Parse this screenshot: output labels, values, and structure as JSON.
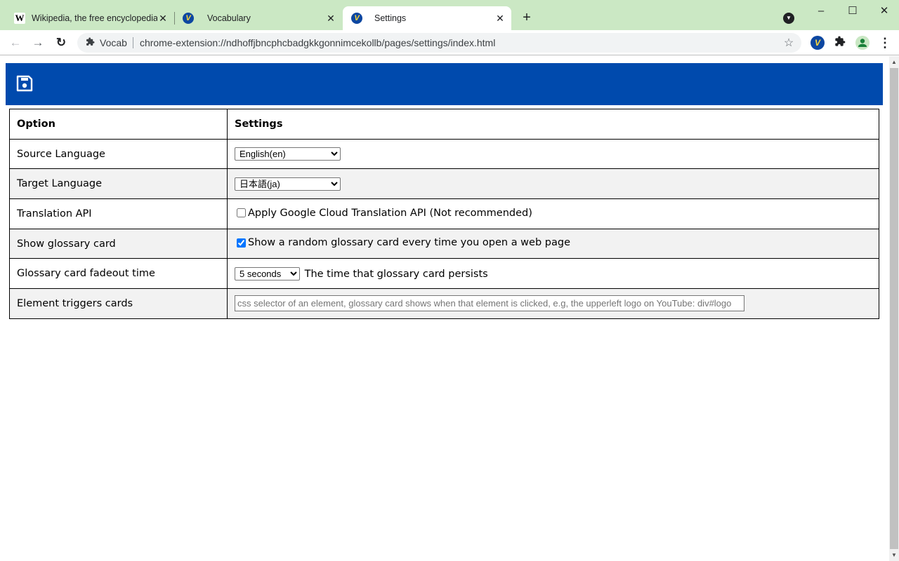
{
  "browser": {
    "tabs": [
      {
        "title": "Wikipedia, the free encyclopedia",
        "favicon": "wikipedia-w-icon",
        "favicon_glyph": "W",
        "active": false
      },
      {
        "title": "Vocabulary",
        "favicon": "vocab-extension-icon",
        "favicon_glyph": "V",
        "active": false
      },
      {
        "title": "Settings",
        "favicon": "vocab-extension-icon",
        "favicon_glyph": "V",
        "active": true
      }
    ],
    "close_glyph": "✕",
    "new_tab_glyph": "+",
    "tab_search_glyph": "▼",
    "window_controls": {
      "minimize": "–",
      "maximize": "☐",
      "close": "✕"
    },
    "nav": {
      "back": "←",
      "forward": "→",
      "reload": "↻"
    },
    "omnibox": {
      "chip_icon": "puzzle-piece-icon",
      "chip_label": "Vocab",
      "url": "chrome-extension://ndhoffjbncphcbadgkkgonnimcekollb/pages/settings/index.html",
      "bookmark_glyph": "☆"
    },
    "toolbar_icons": {
      "vocab": "V",
      "extensions": "✚",
      "profile": "●",
      "menu": "⋮"
    }
  },
  "page": {
    "header": {
      "save_icon": "floppy-disk-icon",
      "accent_color": "#004aad"
    },
    "table": {
      "headers": {
        "option": "Option",
        "settings": "Settings"
      },
      "rows": [
        {
          "option": "Source Language",
          "type": "select",
          "value": "English(en)"
        },
        {
          "option": "Target Language",
          "type": "select",
          "value": "日本語(ja)"
        },
        {
          "option": "Translation API",
          "type": "checkbox",
          "checked": false,
          "label": "Apply Google Cloud Translation API (Not recommended)"
        },
        {
          "option": "Show glossary card",
          "type": "checkbox",
          "checked": true,
          "label": "Show a random glossary card every time you open a web page"
        },
        {
          "option": "Glossary card fadeout time",
          "type": "select",
          "value": "5 seconds",
          "label": "The time that glossary card persists"
        },
        {
          "option": "Element triggers cards",
          "type": "text",
          "value": "",
          "placeholder": "css selector of an element, glossary card shows when that element is clicked, e.g, the upperleft logo on YouTube: div#logo"
        }
      ]
    }
  }
}
